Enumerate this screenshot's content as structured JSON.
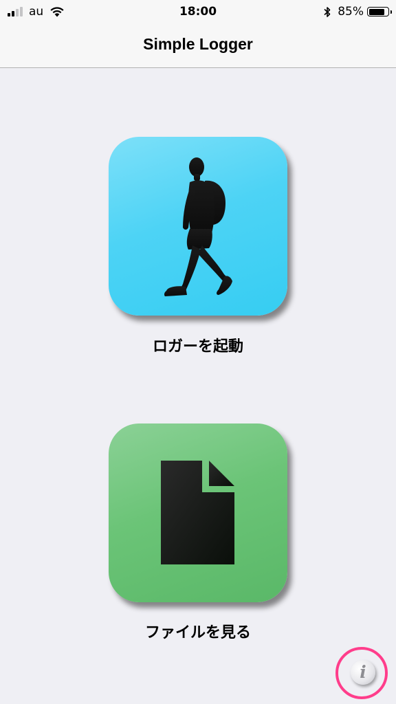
{
  "status_bar": {
    "carrier": "au",
    "time": "18:00",
    "battery_percent_text": "85%",
    "battery_level": 0.85,
    "signal_bars": 2,
    "signal_bars_total": 4,
    "icons": [
      "cellular-signal-icon",
      "wifi-icon",
      "bluetooth-icon",
      "battery-icon"
    ]
  },
  "nav": {
    "title": "Simple Logger"
  },
  "main": {
    "start_logger": {
      "label": "ロガーを起動",
      "icon": "walking-person-icon",
      "color": "#4dd3f5"
    },
    "view_files": {
      "label": "ファイルを見る",
      "icon": "document-icon",
      "color": "#6bc477"
    }
  },
  "info_button": {
    "glyph": "i",
    "icon": "info-icon",
    "highlight_color": "#ff3d8b"
  }
}
